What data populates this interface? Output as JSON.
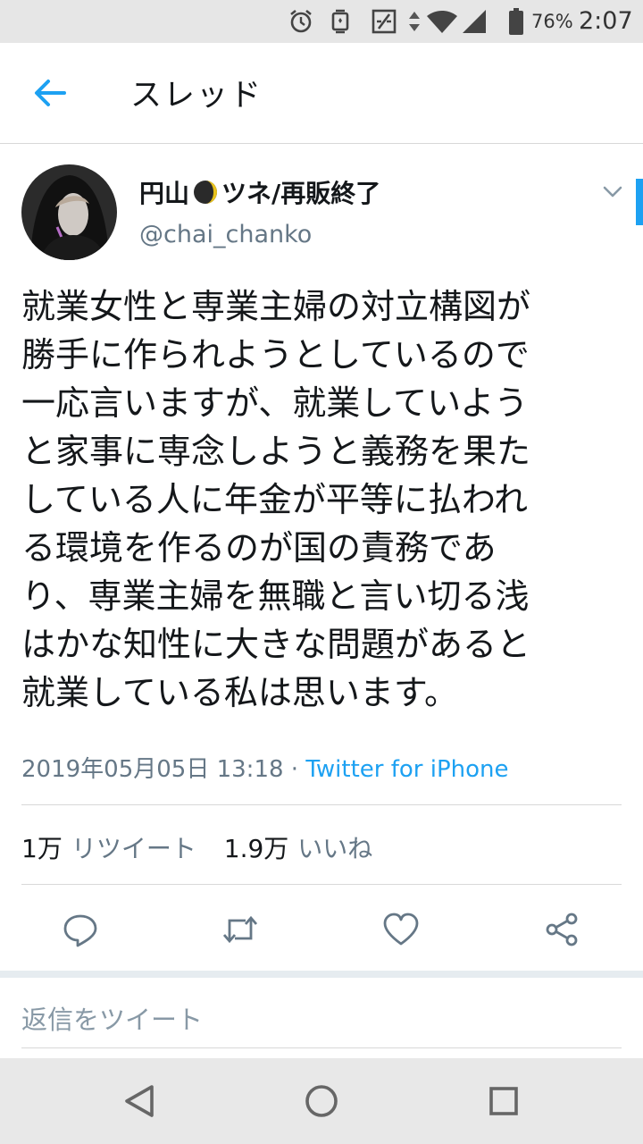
{
  "status_bar": {
    "battery_percent": "76%",
    "time": "2:07",
    "icons": [
      "alarm-icon",
      "vibrate-icon",
      "data-saver-icon",
      "data-arrows-icon",
      "wifi-icon",
      "signal-icon",
      "battery-icon"
    ]
  },
  "app_bar": {
    "title": "スレッド",
    "back_icon": "arrow-left-icon"
  },
  "tweet": {
    "display_name_prefix": "円山",
    "display_name_emoji": "crescent-moon-icon",
    "display_name_suffix": "ツネ/再販終了",
    "handle": "@chai_chanko",
    "text": "就業女性と専業主婦の対立構図が\n勝手に作られようとしているので\n一応言いますが、就業していよう\nと家事に専念しようと義務を果た\nしている人に年金が平等に払われ\nる環境を作るのが国の責務であ\nり、専業主婦を無職と言い切る浅\nはかな知性に大きな問題があると\n就業している私は思います。",
    "timestamp": "2019年05月05日 13:18",
    "separator": "·",
    "source": "Twitter for iPhone",
    "retweet_count": "1万",
    "retweet_label": "リツイート",
    "like_count": "1.9万",
    "like_label": "いいね"
  },
  "actions": [
    "reply-icon",
    "retweet-icon",
    "like-icon",
    "share-icon"
  ],
  "reply_box": {
    "placeholder": "返信をツイート"
  },
  "nav_bar": [
    "back-triangle-icon",
    "home-circle-icon",
    "recents-square-icon"
  ],
  "colors": {
    "accent": "#1da1f2",
    "text_primary": "#14171a",
    "text_secondary": "#657786"
  }
}
